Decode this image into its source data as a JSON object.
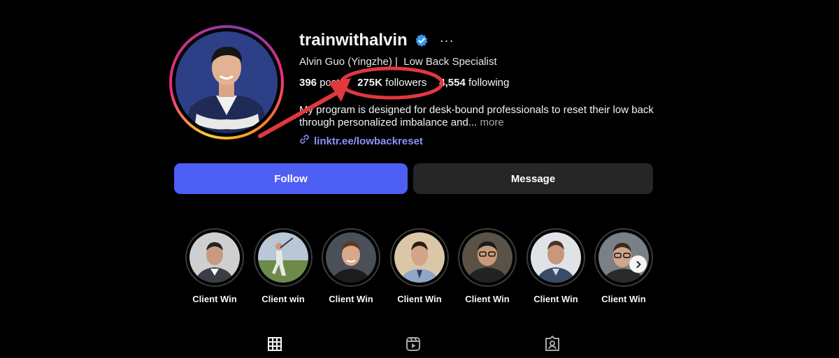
{
  "profile": {
    "username": "trainwithalvin",
    "verified_icon": "verified-badge-icon",
    "more_icon": "more-options-icon",
    "full_name": "Alvin Guo (Yingzhe) |  Low Back Specialist",
    "stats": {
      "posts_count": "396",
      "posts_label": "posts",
      "followers_count": "275K",
      "followers_label": "followers",
      "following_count": "4,554",
      "following_label": "following"
    },
    "bio_text": "My program is designed for desk-bound professionals to reset their low back through personalized imbalance and...",
    "bio_more": "more",
    "link_icon": "link-icon",
    "link_text": "linktr.ee/lowbackreset"
  },
  "actions": {
    "follow_label": "Follow",
    "message_label": "Message"
  },
  "highlights": [
    {
      "label": "Client Win"
    },
    {
      "label": "Client win"
    },
    {
      "label": "Client Win"
    },
    {
      "label": "Client Win"
    },
    {
      "label": "Client Win"
    },
    {
      "label": "Client Win"
    },
    {
      "label": "Client Win"
    }
  ],
  "highlights_next_icon": "chevron-right-icon",
  "tabs": [
    {
      "icon": "grid-icon"
    },
    {
      "icon": "reels-icon"
    },
    {
      "icon": "tagged-icon"
    }
  ],
  "colors": {
    "background": "#000000",
    "follow_button": "#4e5ff5",
    "message_button": "#262626",
    "link": "#8a92ff",
    "verified": "#3897f0",
    "annotation_red": "#e0383e"
  }
}
